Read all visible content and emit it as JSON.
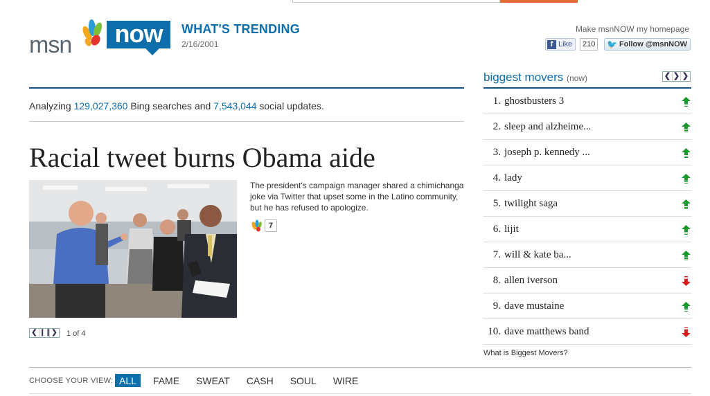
{
  "header": {
    "logo_text": "msn",
    "logo_badge": "now",
    "section_title": "WHAT'S TRENDING",
    "date": "2/16/2001",
    "make_homepage": "Make msnNOW my homepage",
    "fb_like_label": "Like",
    "fb_like_count": "210",
    "twitter_follow_label": "Follow @msnNOW"
  },
  "stats": {
    "prefix": "Analyzing",
    "bing_searches": "129,027,360",
    "middle": "Bing searches and",
    "social_updates": "7,543,044",
    "suffix": "social updates."
  },
  "story": {
    "headline": "Racial tweet burns Obama aide",
    "summary": "The president's campaign manager shared a chimichanga joke via Twitter that upset some in the Latino community, but he has refused to apologize.",
    "comment_count": "7",
    "pager_prev": "❮",
    "pager_pause": "❙❙",
    "pager_next": "❯",
    "page_indicator": "1 of 4"
  },
  "movers": {
    "title": "biggest movers",
    "subtitle": "(now)",
    "nav_prev": "❮",
    "nav_mid": "❯",
    "nav_next": "❯",
    "items": [
      {
        "rank": "1.",
        "term": "ghostbusters 3",
        "direction": "up"
      },
      {
        "rank": "2.",
        "term": "sleep and alzheime...",
        "direction": "up"
      },
      {
        "rank": "3.",
        "term": "joseph p. kennedy ...",
        "direction": "up"
      },
      {
        "rank": "4.",
        "term": "lady",
        "direction": "up"
      },
      {
        "rank": "5.",
        "term": "twilight saga",
        "direction": "up"
      },
      {
        "rank": "6.",
        "term": "lijit",
        "direction": "up"
      },
      {
        "rank": "7.",
        "term": "will & kate ba...",
        "direction": "up"
      },
      {
        "rank": "8.",
        "term": "allen iverson",
        "direction": "down"
      },
      {
        "rank": "9.",
        "term": "dave mustaine",
        "direction": "up"
      },
      {
        "rank": "10.",
        "term": "dave matthews band",
        "direction": "down"
      }
    ],
    "what_is_link": "What is Biggest Movers?"
  },
  "views": {
    "label": "CHOOSE YOUR VIEW:",
    "tabs": [
      "ALL",
      "FAME",
      "SWEAT",
      "CASH",
      "SOUL",
      "WIRE"
    ],
    "active": "ALL"
  },
  "colors": {
    "brand_blue": "#0d6eac",
    "up_arrow": "#1a9a2a",
    "down_arrow": "#d81a1a"
  }
}
